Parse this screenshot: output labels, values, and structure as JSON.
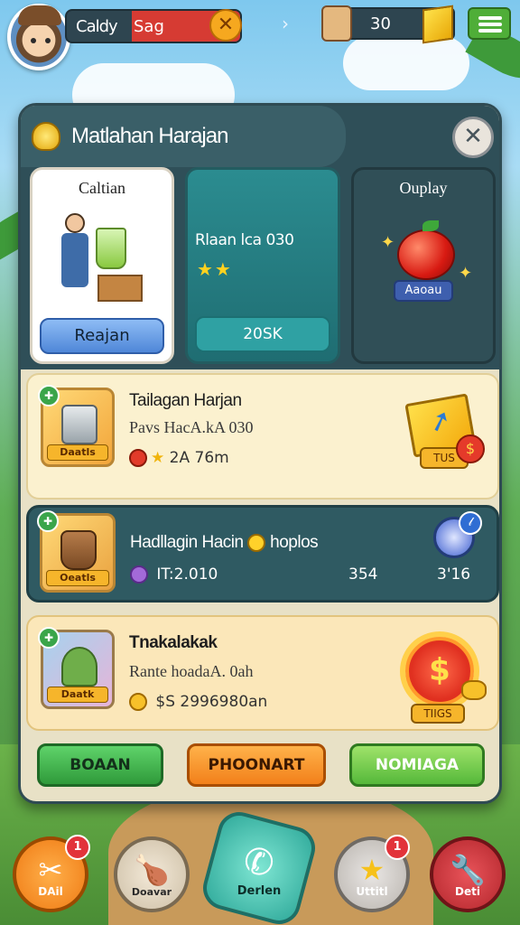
{
  "topbar": {
    "player_name": "Caldy",
    "player_tag": "Sag",
    "currency_value": "30"
  },
  "panel": {
    "title": "Matlahan Harajan",
    "close_symbol": "✕",
    "cards": [
      {
        "title": "Caltian",
        "button_label": "Reajan"
      },
      {
        "info": "Rlaan lca 030",
        "button_label": "20SK"
      },
      {
        "title": "Ouplay",
        "tag_label": "Aaoau"
      }
    ],
    "rows": [
      {
        "thumb_label": "Daatls",
        "title": "Tailagan Harjan",
        "subtitle": "Pavs HacA.kA 030",
        "meta": "2A 76m",
        "reward_label": "TUS"
      },
      {
        "thumb_label": "Oeatls",
        "title": "Hadllagin Hacin",
        "title_suffix": "hoplos",
        "meta": "IT:2.010",
        "value_mid": "354",
        "value_end": "3'16"
      },
      {
        "thumb_label": "Daatk",
        "title": "Tnakalakak",
        "subtitle": "Rante hoadaA. 0ah",
        "meta": "$S 2996980an",
        "reward_label": "TIIGS"
      }
    ],
    "buttons": {
      "left": "BOAAN",
      "middle": "PHOONART",
      "right": "NOMIAGA"
    }
  },
  "bottom_nav": [
    {
      "label": "DAil",
      "badge": "1"
    },
    {
      "label": "Doavar"
    },
    {
      "label": "Derlen"
    },
    {
      "label": "Uttitl",
      "badge": "1"
    },
    {
      "label": "Deti"
    }
  ]
}
